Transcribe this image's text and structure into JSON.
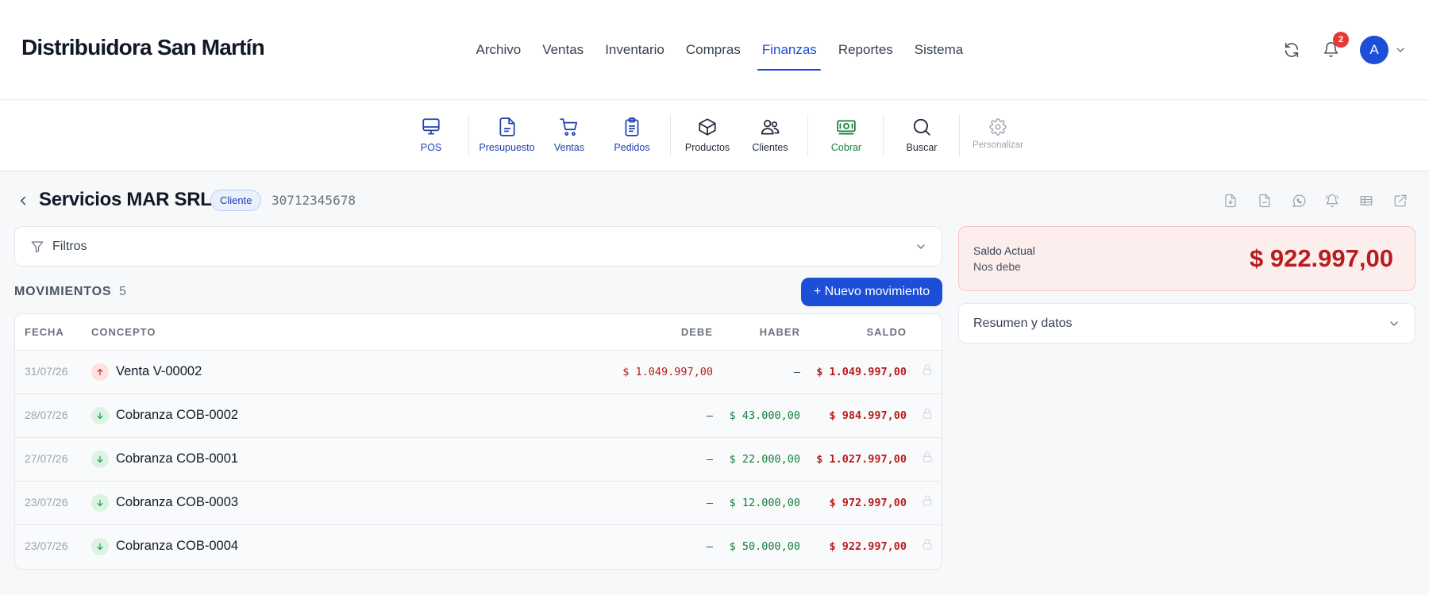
{
  "app": {
    "brand": "Distribuidora San Martín",
    "nav": [
      {
        "label": "Archivo"
      },
      {
        "label": "Ventas"
      },
      {
        "label": "Inventario"
      },
      {
        "label": "Compras"
      },
      {
        "label": "Finanzas",
        "active": true
      },
      {
        "label": "Reportes"
      },
      {
        "label": "Sistema"
      }
    ],
    "notifications_count": "2",
    "avatar_initial": "A"
  },
  "toolbar": {
    "items": [
      {
        "label": "POS",
        "icon": "monitor-icon"
      },
      {
        "label": "Presupuesto",
        "icon": "document-icon"
      },
      {
        "label": "Ventas",
        "icon": "cart-icon"
      },
      {
        "label": "Pedidos",
        "icon": "clipboard-icon"
      },
      {
        "label": "Productos",
        "icon": "box-icon"
      },
      {
        "label": "Clientes",
        "icon": "users-icon"
      },
      {
        "label": "Cobrar",
        "icon": "cash-icon"
      },
      {
        "label": "Buscar",
        "icon": "search-icon"
      },
      {
        "label": "Personalizar",
        "icon": "gear-icon"
      }
    ]
  },
  "client": {
    "name": "Servicios MAR SRL",
    "tag": "Cliente",
    "cuit": "30712345678"
  },
  "filters": {
    "label": "Filtros"
  },
  "movements": {
    "title": "MOVIMIENTOS",
    "count": "5",
    "new_button": "+ Nuevo movimiento",
    "columns": {
      "fecha": "FECHA",
      "concepto": "CONCEPTO",
      "debe": "DEBE",
      "haber": "HABER",
      "saldo": "SALDO"
    },
    "rows": [
      {
        "fecha": "31/07/26",
        "concepto": "Venta V-00002",
        "direction": "up",
        "debe": "$ 1.049.997,00",
        "haber": "—",
        "saldo": "$ 1.049.997,00"
      },
      {
        "fecha": "28/07/26",
        "concepto": "Cobranza COB-0002",
        "direction": "down",
        "debe": "—",
        "haber": "$ 43.000,00",
        "saldo": "$ 984.997,00"
      },
      {
        "fecha": "27/07/26",
        "concepto": "Cobranza COB-0001",
        "direction": "down",
        "debe": "—",
        "haber": "$ 22.000,00",
        "saldo": "$ 1.027.997,00"
      },
      {
        "fecha": "23/07/26",
        "concepto": "Cobranza COB-0003",
        "direction": "down",
        "debe": "—",
        "haber": "$ 12.000,00",
        "saldo": "$ 972.997,00"
      },
      {
        "fecha": "23/07/26",
        "concepto": "Cobranza COB-0004",
        "direction": "down",
        "debe": "—",
        "haber": "$ 50.000,00",
        "saldo": "$ 922.997,00"
      }
    ]
  },
  "balance": {
    "label": "Saldo Actual",
    "sublabel": "Nos debe",
    "amount": "$ 922.997,00"
  },
  "summary": {
    "label": "Resumen y datos"
  },
  "colors": {
    "primary": "#1d4ed8",
    "debit": "#b91c1c",
    "credit": "#15803d",
    "balance_bg": "#fdeeee"
  }
}
